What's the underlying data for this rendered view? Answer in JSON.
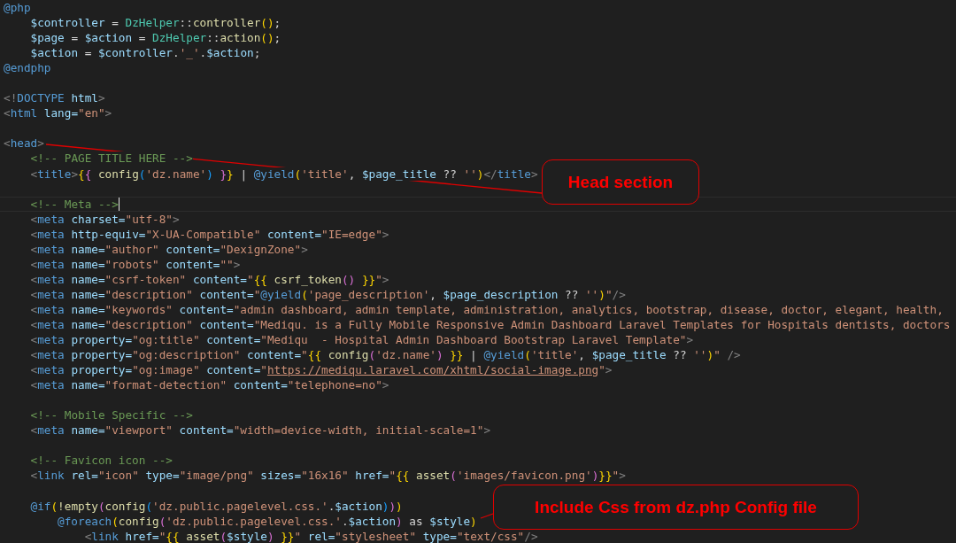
{
  "editor": {
    "lines": [
      {
        "kind": "code",
        "current": false,
        "tokens": [
          {
            "kind": "directive",
            "text": "@php"
          }
        ],
        "children": [
          {
            "kind": "code",
            "current": false,
            "tokens": [
              {
                "kind": "variable",
                "text": "$controller"
              },
              {
                "kind": "plain",
                "text": " = "
              },
              {
                "kind": "class",
                "text": "DzHelper"
              },
              {
                "kind": "plain",
                "text": "::"
              },
              {
                "kind": "function",
                "text": "controller"
              },
              {
                "kind": "bracket1",
                "text": "()"
              },
              {
                "kind": "plain",
                "text": ";"
              }
            ]
          },
          {
            "kind": "code",
            "current": false,
            "tokens": [
              {
                "kind": "variable",
                "text": "$page"
              },
              {
                "kind": "plain",
                "text": " = "
              },
              {
                "kind": "variable",
                "text": "$action"
              },
              {
                "kind": "plain",
                "text": " = "
              },
              {
                "kind": "class",
                "text": "DzHelper"
              },
              {
                "kind": "plain",
                "text": "::"
              },
              {
                "kind": "function",
                "text": "action"
              },
              {
                "kind": "bracket1",
                "text": "()"
              },
              {
                "kind": "plain",
                "text": ";"
              }
            ]
          },
          {
            "kind": "code",
            "current": false,
            "tokens": [
              {
                "kind": "variable",
                "text": "$action"
              },
              {
                "kind": "plain",
                "text": " = "
              },
              {
                "kind": "variable",
                "text": "$controller"
              },
              {
                "kind": "plain",
                "text": "."
              },
              {
                "kind": "string",
                "text": "'_'"
              },
              {
                "kind": "plain",
                "text": "."
              },
              {
                "kind": "variable",
                "text": "$action"
              },
              {
                "kind": "plain",
                "text": ";"
              }
            ]
          }
        ]
      },
      {
        "kind": "code",
        "current": false,
        "tokens": [
          {
            "kind": "directive",
            "text": "@endphp"
          }
        ]
      },
      {
        "kind": "blank"
      },
      {
        "kind": "code",
        "current": false,
        "tokens": [
          {
            "kind": "punct",
            "text": "<!"
          },
          {
            "kind": "tag",
            "text": "DOCTYPE"
          },
          {
            "kind": "attr",
            "text": " html"
          },
          {
            "kind": "punct",
            "text": ">"
          }
        ]
      },
      {
        "kind": "code",
        "current": false,
        "tokens": [
          {
            "kind": "punct",
            "text": "<"
          },
          {
            "kind": "tag",
            "text": "html"
          },
          {
            "kind": "attr",
            "text": " lang="
          },
          {
            "kind": "string",
            "text": "\"en\""
          },
          {
            "kind": "punct",
            "text": ">"
          }
        ]
      },
      {
        "kind": "blank"
      },
      {
        "kind": "code",
        "current": false,
        "tokens": [
          {
            "kind": "punct",
            "text": "<"
          },
          {
            "kind": "tag",
            "text": "head"
          },
          {
            "kind": "punct",
            "text": ">"
          }
        ],
        "children": [
          {
            "kind": "code",
            "current": false,
            "tokens": [
              {
                "kind": "comment",
                "text": "<!-- PAGE TITLE HERE -->"
              }
            ]
          },
          {
            "kind": "code",
            "current": false,
            "tokens": [
              {
                "kind": "punct",
                "text": "<"
              },
              {
                "kind": "tag",
                "text": "title"
              },
              {
                "kind": "punct",
                "text": ">"
              },
              {
                "kind": "bracket1",
                "text": "{"
              },
              {
                "kind": "bracket2",
                "text": "{ "
              },
              {
                "kind": "function",
                "text": "config"
              },
              {
                "kind": "bracket3",
                "text": "("
              },
              {
                "kind": "string",
                "text": "'dz.name'"
              },
              {
                "kind": "bracket3",
                "text": ")"
              },
              {
                "kind": "bracket2",
                "text": " }"
              },
              {
                "kind": "bracket1",
                "text": "}"
              },
              {
                "kind": "plain",
                "text": " | "
              },
              {
                "kind": "directive",
                "text": "@yield"
              },
              {
                "kind": "bracket1",
                "text": "("
              },
              {
                "kind": "string",
                "text": "'title'"
              },
              {
                "kind": "plain",
                "text": ", "
              },
              {
                "kind": "variable",
                "text": "$page_title"
              },
              {
                "kind": "plain",
                "text": " ?? "
              },
              {
                "kind": "string",
                "text": "''"
              },
              {
                "kind": "bracket1",
                "text": ")"
              },
              {
                "kind": "punct",
                "text": "</"
              },
              {
                "kind": "tag",
                "text": "title"
              },
              {
                "kind": "punct",
                "text": ">"
              }
            ]
          },
          {
            "kind": "blank"
          },
          {
            "kind": "code",
            "current": true,
            "tokens": [
              {
                "kind": "comment",
                "text": "<!-- Meta -->"
              }
            ]
          },
          {
            "kind": "code",
            "current": false,
            "tokens": [
              {
                "kind": "punct",
                "text": "<"
              },
              {
                "kind": "tag",
                "text": "meta"
              },
              {
                "kind": "attr",
                "text": " charset="
              },
              {
                "kind": "string",
                "text": "\"utf-8\""
              },
              {
                "kind": "punct",
                "text": ">"
              }
            ]
          },
          {
            "kind": "code",
            "current": false,
            "tokens": [
              {
                "kind": "punct",
                "text": "<"
              },
              {
                "kind": "tag",
                "text": "meta"
              },
              {
                "kind": "attr",
                "text": " http-equiv="
              },
              {
                "kind": "string",
                "text": "\"X-UA-Compatible\""
              },
              {
                "kind": "attr",
                "text": " content="
              },
              {
                "kind": "string",
                "text": "\"IE=edge\""
              },
              {
                "kind": "punct",
                "text": ">"
              }
            ]
          },
          {
            "kind": "code",
            "current": false,
            "tokens": [
              {
                "kind": "punct",
                "text": "<"
              },
              {
                "kind": "tag",
                "text": "meta"
              },
              {
                "kind": "attr",
                "text": " name="
              },
              {
                "kind": "string",
                "text": "\"author\""
              },
              {
                "kind": "attr",
                "text": " content="
              },
              {
                "kind": "string",
                "text": "\"DexignZone\""
              },
              {
                "kind": "punct",
                "text": ">"
              }
            ]
          },
          {
            "kind": "code",
            "current": false,
            "tokens": [
              {
                "kind": "punct",
                "text": "<"
              },
              {
                "kind": "tag",
                "text": "meta"
              },
              {
                "kind": "attr",
                "text": " name="
              },
              {
                "kind": "string",
                "text": "\"robots\""
              },
              {
                "kind": "attr",
                "text": " content="
              },
              {
                "kind": "string",
                "text": "\"\""
              },
              {
                "kind": "punct",
                "text": ">"
              }
            ]
          },
          {
            "kind": "code",
            "current": false,
            "tokens": [
              {
                "kind": "punct",
                "text": "<"
              },
              {
                "kind": "tag",
                "text": "meta"
              },
              {
                "kind": "attr",
                "text": " name="
              },
              {
                "kind": "string",
                "text": "\"csrf-token\""
              },
              {
                "kind": "attr",
                "text": " content="
              },
              {
                "kind": "string",
                "text": "\""
              },
              {
                "kind": "bracket1",
                "text": "{{ "
              },
              {
                "kind": "function",
                "text": "csrf_token"
              },
              {
                "kind": "bracket2",
                "text": "()"
              },
              {
                "kind": "bracket1",
                "text": " }}"
              },
              {
                "kind": "string",
                "text": "\""
              },
              {
                "kind": "punct",
                "text": ">"
              }
            ]
          },
          {
            "kind": "code",
            "current": false,
            "tokens": [
              {
                "kind": "punct",
                "text": "<"
              },
              {
                "kind": "tag",
                "text": "meta"
              },
              {
                "kind": "attr",
                "text": " name="
              },
              {
                "kind": "string",
                "text": "\"description\""
              },
              {
                "kind": "attr",
                "text": " content="
              },
              {
                "kind": "string",
                "text": "\""
              },
              {
                "kind": "directive",
                "text": "@yield"
              },
              {
                "kind": "bracket1",
                "text": "("
              },
              {
                "kind": "string",
                "text": "'page_description'"
              },
              {
                "kind": "plain",
                "text": ", "
              },
              {
                "kind": "variable",
                "text": "$page_description"
              },
              {
                "kind": "plain",
                "text": " ?? "
              },
              {
                "kind": "string",
                "text": "''"
              },
              {
                "kind": "bracket1",
                "text": ")"
              },
              {
                "kind": "string",
                "text": "\""
              },
              {
                "kind": "punct",
                "text": "/>"
              }
            ]
          },
          {
            "kind": "code",
            "current": false,
            "tokens": [
              {
                "kind": "punct",
                "text": "<"
              },
              {
                "kind": "tag",
                "text": "meta"
              },
              {
                "kind": "attr",
                "text": " name="
              },
              {
                "kind": "string",
                "text": "\"keywords\""
              },
              {
                "kind": "attr",
                "text": " content="
              },
              {
                "kind": "string",
                "text": "\"admin dashboard, admin template, administration, analytics, bootstrap, disease, doctor, elegant, health,"
              }
            ]
          },
          {
            "kind": "code",
            "current": false,
            "tokens": [
              {
                "kind": "punct",
                "text": "<"
              },
              {
                "kind": "tag",
                "text": "meta"
              },
              {
                "kind": "attr",
                "text": " name="
              },
              {
                "kind": "string",
                "text": "\"description\""
              },
              {
                "kind": "attr",
                "text": " content="
              },
              {
                "kind": "string",
                "text": "\"Mediqu. is a Fully Mobile Responsive Admin Dashboard Laravel Templates for Hospitals dentists, doctors"
              }
            ]
          },
          {
            "kind": "code",
            "current": false,
            "tokens": [
              {
                "kind": "punct",
                "text": "<"
              },
              {
                "kind": "tag",
                "text": "meta"
              },
              {
                "kind": "attr",
                "text": " property="
              },
              {
                "kind": "string",
                "text": "\"og:title\""
              },
              {
                "kind": "attr",
                "text": " content="
              },
              {
                "kind": "string",
                "text": "\"Mediqu  - Hospital Admin Dashboard Bootstrap Laravel Template\""
              },
              {
                "kind": "punct",
                "text": ">"
              }
            ]
          },
          {
            "kind": "code",
            "current": false,
            "tokens": [
              {
                "kind": "punct",
                "text": "<"
              },
              {
                "kind": "tag",
                "text": "meta"
              },
              {
                "kind": "attr",
                "text": " property="
              },
              {
                "kind": "string",
                "text": "\"og:description\""
              },
              {
                "kind": "attr",
                "text": " content="
              },
              {
                "kind": "string",
                "text": "\""
              },
              {
                "kind": "bracket1",
                "text": "{{ "
              },
              {
                "kind": "function",
                "text": "config"
              },
              {
                "kind": "bracket2",
                "text": "("
              },
              {
                "kind": "string",
                "text": "'dz.name'"
              },
              {
                "kind": "bracket2",
                "text": ")"
              },
              {
                "kind": "bracket1",
                "text": " }}"
              },
              {
                "kind": "plain",
                "text": " | "
              },
              {
                "kind": "directive",
                "text": "@yield"
              },
              {
                "kind": "bracket1",
                "text": "("
              },
              {
                "kind": "string",
                "text": "'title'"
              },
              {
                "kind": "plain",
                "text": ", "
              },
              {
                "kind": "variable",
                "text": "$page_title"
              },
              {
                "kind": "plain",
                "text": " ?? "
              },
              {
                "kind": "string",
                "text": "''"
              },
              {
                "kind": "bracket1",
                "text": ")"
              },
              {
                "kind": "string",
                "text": "\""
              },
              {
                "kind": "punct",
                "text": " />"
              }
            ]
          },
          {
            "kind": "code",
            "current": false,
            "tokens": [
              {
                "kind": "punct",
                "text": "<"
              },
              {
                "kind": "tag",
                "text": "meta"
              },
              {
                "kind": "attr",
                "text": " property="
              },
              {
                "kind": "string",
                "text": "\"og:image\""
              },
              {
                "kind": "attr",
                "text": " content="
              },
              {
                "kind": "string",
                "text": "\""
              },
              {
                "kind": "link",
                "text": "https://mediqu.laravel.com/xhtml/social-image.png"
              },
              {
                "kind": "string",
                "text": "\""
              },
              {
                "kind": "punct",
                "text": ">"
              }
            ]
          },
          {
            "kind": "code",
            "current": false,
            "tokens": [
              {
                "kind": "punct",
                "text": "<"
              },
              {
                "kind": "tag",
                "text": "meta"
              },
              {
                "kind": "attr",
                "text": " name="
              },
              {
                "kind": "string",
                "text": "\"format-detection\""
              },
              {
                "kind": "attr",
                "text": " content="
              },
              {
                "kind": "string",
                "text": "\"telephone=no\""
              },
              {
                "kind": "punct",
                "text": ">"
              }
            ]
          },
          {
            "kind": "blank"
          },
          {
            "kind": "code",
            "current": false,
            "tokens": [
              {
                "kind": "comment",
                "text": "<!-- Mobile Specific -->"
              }
            ]
          },
          {
            "kind": "code",
            "current": false,
            "tokens": [
              {
                "kind": "punct",
                "text": "<"
              },
              {
                "kind": "tag",
                "text": "meta"
              },
              {
                "kind": "attr",
                "text": " name="
              },
              {
                "kind": "string",
                "text": "\"viewport\""
              },
              {
                "kind": "attr",
                "text": " content="
              },
              {
                "kind": "string",
                "text": "\"width=device-width, initial-scale=1\""
              },
              {
                "kind": "punct",
                "text": ">"
              }
            ]
          },
          {
            "kind": "blank"
          },
          {
            "kind": "code",
            "current": false,
            "tokens": [
              {
                "kind": "comment",
                "text": "<!-- Favicon icon -->"
              }
            ]
          },
          {
            "kind": "code",
            "current": false,
            "tokens": [
              {
                "kind": "punct",
                "text": "<"
              },
              {
                "kind": "tag",
                "text": "link"
              },
              {
                "kind": "attr",
                "text": " rel="
              },
              {
                "kind": "string",
                "text": "\"icon\""
              },
              {
                "kind": "attr",
                "text": " type="
              },
              {
                "kind": "string",
                "text": "\"image/png\""
              },
              {
                "kind": "attr",
                "text": " sizes="
              },
              {
                "kind": "string",
                "text": "\"16x16\""
              },
              {
                "kind": "attr",
                "text": " href="
              },
              {
                "kind": "string",
                "text": "\""
              },
              {
                "kind": "bracket1",
                "text": "{{ "
              },
              {
                "kind": "function",
                "text": "asset"
              },
              {
                "kind": "bracket2",
                "text": "("
              },
              {
                "kind": "string",
                "text": "'images/favicon.png'"
              },
              {
                "kind": "bracket2",
                "text": ")"
              },
              {
                "kind": "bracket1",
                "text": "}}"
              },
              {
                "kind": "string",
                "text": "\""
              },
              {
                "kind": "punct",
                "text": ">"
              }
            ]
          },
          {
            "kind": "blank"
          },
          {
            "kind": "code",
            "current": false,
            "tokens": [
              {
                "kind": "directive",
                "text": "@if"
              },
              {
                "kind": "bracket1",
                "text": "("
              },
              {
                "kind": "function",
                "text": "!empty"
              },
              {
                "kind": "bracket2",
                "text": "("
              },
              {
                "kind": "function",
                "text": "config"
              },
              {
                "kind": "bracket3",
                "text": "("
              },
              {
                "kind": "string",
                "text": "'dz.public.pagelevel.css.'"
              },
              {
                "kind": "plain",
                "text": "."
              },
              {
                "kind": "variable",
                "text": "$action"
              },
              {
                "kind": "bracket3",
                "text": ")"
              },
              {
                "kind": "bracket2",
                "text": ")"
              },
              {
                "kind": "bracket1",
                "text": ")"
              }
            ],
            "children": [
              {
                "kind": "code",
                "current": false,
                "tokens": [
                  {
                    "kind": "directive",
                    "text": "@foreach"
                  },
                  {
                    "kind": "bracket1",
                    "text": "("
                  },
                  {
                    "kind": "function",
                    "text": "config"
                  },
                  {
                    "kind": "bracket2",
                    "text": "("
                  },
                  {
                    "kind": "string",
                    "text": "'dz.public.pagelevel.css.'"
                  },
                  {
                    "kind": "plain",
                    "text": "."
                  },
                  {
                    "kind": "variable",
                    "text": "$action"
                  },
                  {
                    "kind": "bracket2",
                    "text": ")"
                  },
                  {
                    "kind": "plain",
                    "text": " as "
                  },
                  {
                    "kind": "variable",
                    "text": "$style"
                  },
                  {
                    "kind": "bracket1",
                    "text": ")"
                  }
                ],
                "children": [
                  {
                    "kind": "code",
                    "current": false,
                    "tokens": [
                      {
                        "kind": "punct",
                        "text": "<"
                      },
                      {
                        "kind": "tag",
                        "text": "link"
                      },
                      {
                        "kind": "attr",
                        "text": " href="
                      },
                      {
                        "kind": "string",
                        "text": "\""
                      },
                      {
                        "kind": "bracket1",
                        "text": "{{ "
                      },
                      {
                        "kind": "function",
                        "text": "asset"
                      },
                      {
                        "kind": "bracket2",
                        "text": "("
                      },
                      {
                        "kind": "variable",
                        "text": "$style"
                      },
                      {
                        "kind": "bracket2",
                        "text": ")"
                      },
                      {
                        "kind": "bracket1",
                        "text": " }}"
                      },
                      {
                        "kind": "string",
                        "text": "\""
                      },
                      {
                        "kind": "attr",
                        "text": " rel="
                      },
                      {
                        "kind": "string",
                        "text": "\"stylesheet\""
                      },
                      {
                        "kind": "attr",
                        "text": " type="
                      },
                      {
                        "kind": "string",
                        "text": "\"text/css\""
                      },
                      {
                        "kind": "punct",
                        "text": "/>"
                      }
                    ]
                  }
                ]
              }
            ]
          }
        ]
      }
    ]
  },
  "annotations": [
    {
      "text": "Head section"
    },
    {
      "text": "Include Css from dz.php Config file"
    }
  ]
}
